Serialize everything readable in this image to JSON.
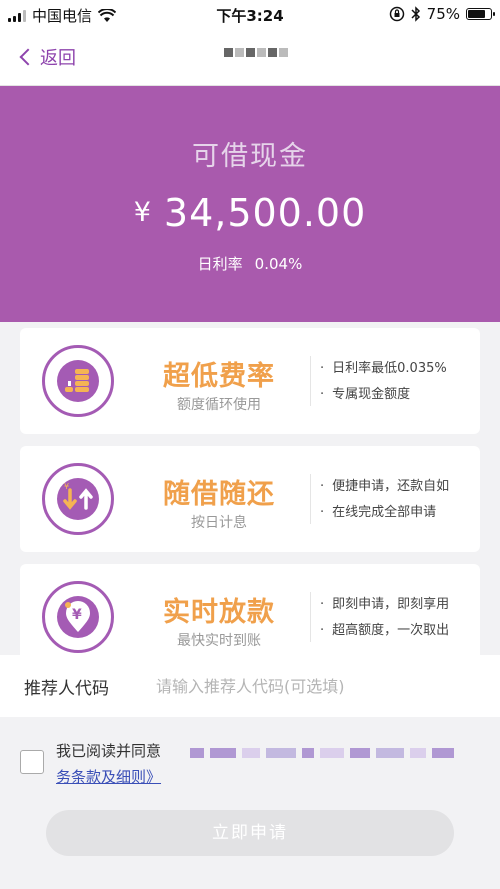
{
  "status_bar": {
    "carrier": "中国电信",
    "time": "下午3:24",
    "battery": "75%",
    "battery_level": 0.75
  },
  "nav": {
    "back_label": "返回",
    "title": ""
  },
  "hero": {
    "label": "可借现金",
    "currency": "¥",
    "amount": "34,500.00",
    "rate_label": "日利率",
    "rate_value": "0.04%"
  },
  "features": [
    {
      "title": "超低费率",
      "subtitle": "额度循环使用",
      "bullets": [
        "日利率最低0.035%",
        "专属现金额度"
      ],
      "icon": "coin-stack-icon"
    },
    {
      "title": "随借随还",
      "subtitle": "按日计息",
      "bullets": [
        "便捷申请，还款自如",
        "在线完成全部申请"
      ],
      "icon": "yen-up-down-arrows-icon"
    },
    {
      "title": "实时放款",
      "subtitle": "最快实时到账",
      "bullets": [
        "即刻申请，即刻享用",
        "超高额度，一次取出"
      ],
      "icon": "yen-pin-icon"
    }
  ],
  "referral": {
    "label": "推荐人代码",
    "placeholder": "请输入推荐人代码(可选填)"
  },
  "agreement": {
    "prefix": "我已阅读并同意",
    "link": "务条款及细则》"
  },
  "apply_label": "立即申请",
  "colors": {
    "brand_purple": "#a95aad",
    "accent_orange": "#f0a04b",
    "link_blue": "#3a4fb7"
  }
}
